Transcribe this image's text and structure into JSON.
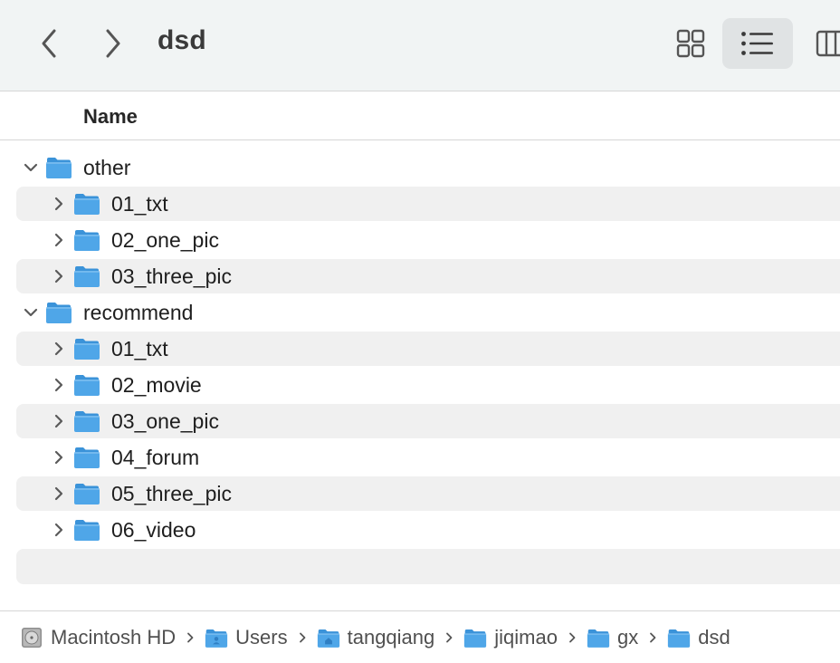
{
  "window": {
    "title": "dsd"
  },
  "toolbar": {
    "back_icon": "chevron-left-icon",
    "forward_icon": "chevron-right-icon",
    "view_modes": [
      {
        "name": "icon-view",
        "icon": "grid-icon",
        "selected": false
      },
      {
        "name": "list-view",
        "icon": "list-icon",
        "selected": true
      },
      {
        "name": "column-view",
        "icon": "columns-icon",
        "selected": false
      }
    ]
  },
  "list": {
    "column_header": "Name",
    "items": [
      {
        "label": "other",
        "level": 0,
        "expanded": true
      },
      {
        "label": "01_txt",
        "level": 1,
        "expanded": false
      },
      {
        "label": "02_one_pic",
        "level": 1,
        "expanded": false
      },
      {
        "label": "03_three_pic",
        "level": 1,
        "expanded": false
      },
      {
        "label": "recommend",
        "level": 0,
        "expanded": true
      },
      {
        "label": "01_txt",
        "level": 1,
        "expanded": false
      },
      {
        "label": "02_movie",
        "level": 1,
        "expanded": false
      },
      {
        "label": "03_one_pic",
        "level": 1,
        "expanded": false
      },
      {
        "label": "04_forum",
        "level": 1,
        "expanded": false
      },
      {
        "label": "05_three_pic",
        "level": 1,
        "expanded": false
      },
      {
        "label": "06_video",
        "level": 1,
        "expanded": false
      }
    ]
  },
  "pathbar": {
    "crumbs": [
      {
        "label": "Macintosh HD",
        "icon": "hard-drive-icon"
      },
      {
        "label": "Users",
        "icon": "users-folder-icon"
      },
      {
        "label": "tangqiang",
        "icon": "home-folder-icon"
      },
      {
        "label": "jiqimao",
        "icon": "folder-icon"
      },
      {
        "label": "gx",
        "icon": "folder-icon"
      },
      {
        "label": "dsd",
        "icon": "folder-icon"
      }
    ]
  },
  "colors": {
    "folder_blue": "#4fa6e8",
    "folder_tab": "#3b93d9",
    "toolbar_bg": "#f1f4f4",
    "row_stripe": "#f0f0f0"
  }
}
